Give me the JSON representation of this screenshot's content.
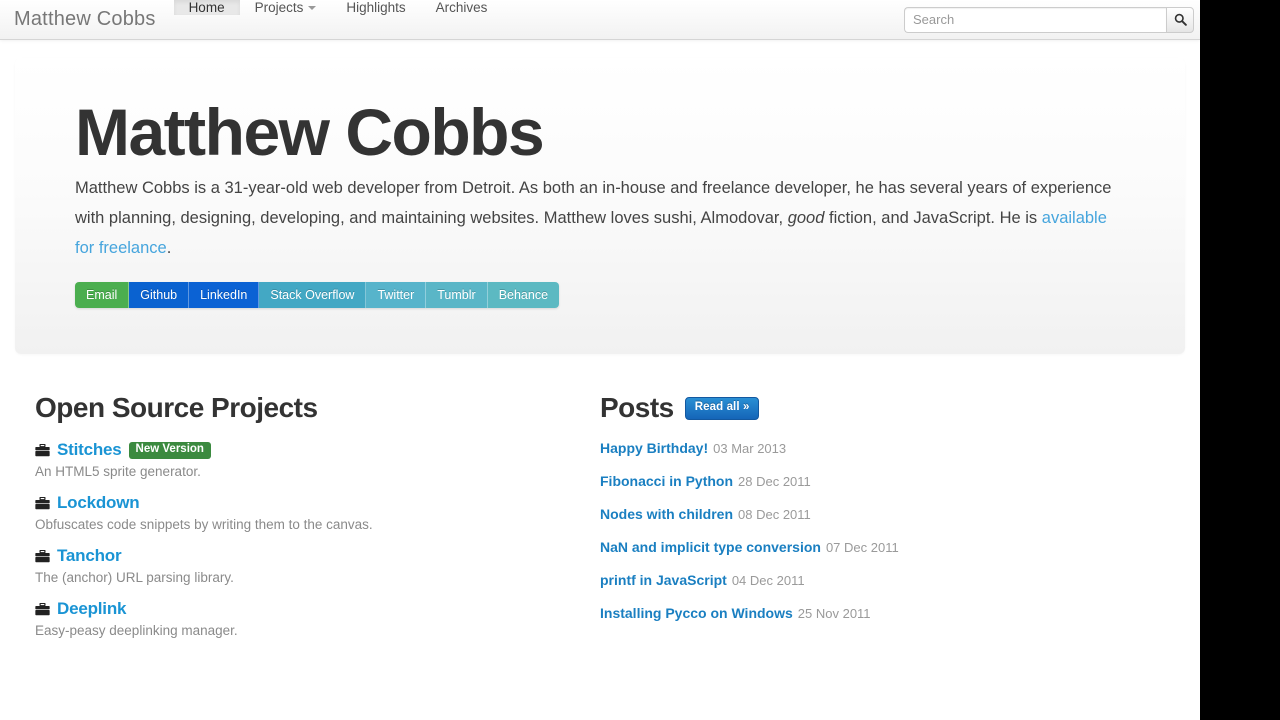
{
  "navbar": {
    "brand": "Matthew Cobbs",
    "items": [
      {
        "label": "Home",
        "active": true,
        "caret": false
      },
      {
        "label": "Projects",
        "active": false,
        "caret": true
      },
      {
        "label": "Highlights",
        "active": false,
        "caret": false
      },
      {
        "label": "Archives",
        "active": false,
        "caret": false
      }
    ],
    "search": {
      "placeholder": "Search",
      "value": "",
      "button_icon": "search-icon"
    }
  },
  "hero": {
    "title": "Matthew Cobbs",
    "bio_part1": "Matthew Cobbs is a 31-year-old web developer from Detroit. As both an in-house and freelance developer, he has several years of experience with planning, designing, developing, and maintaining websites. Matthew loves sushi, Almodovar, ",
    "bio_emphasis": "good",
    "bio_part2": " fiction, and JavaScript. He is ",
    "bio_link": "available for freelance",
    "bio_part3": ".",
    "social": [
      {
        "label": "Email",
        "color": "#4bae4f"
      },
      {
        "label": "Github",
        "color": "#0a62d0"
      },
      {
        "label": "LinkedIn",
        "color": "#0b62d4"
      },
      {
        "label": "Stack Overflow",
        "color": "#43a8c4"
      },
      {
        "label": "Twitter",
        "color": "#57b4cb"
      },
      {
        "label": "Tumblr",
        "color": "#5ab6c7"
      },
      {
        "label": "Behance",
        "color": "#5cb9c2"
      }
    ]
  },
  "projects": {
    "title": "Open Source Projects",
    "items": [
      {
        "icon": "briefcase-icon",
        "name": "Stitches",
        "badge": "New Version",
        "desc": "An HTML5 sprite generator."
      },
      {
        "icon": "briefcase-icon",
        "name": "Lockdown",
        "badge": "",
        "desc": "Obfuscates code snippets by writing them to the canvas."
      },
      {
        "icon": "briefcase-icon",
        "name": "Tanchor",
        "badge": "",
        "desc": "The (anchor) URL parsing library."
      },
      {
        "icon": "briefcase-icon",
        "name": "Deeplink",
        "badge": "",
        "desc": "Easy-peasy deeplinking manager."
      }
    ]
  },
  "posts": {
    "title": "Posts",
    "read_all_label": "Read all »",
    "items": [
      {
        "title": "Happy Birthday!",
        "date": "03 Mar 2013"
      },
      {
        "title": "Fibonacci in Python",
        "date": "28 Dec 2011"
      },
      {
        "title": "Nodes with children",
        "date": "08 Dec 2011"
      },
      {
        "title": "NaN and implicit type conversion",
        "date": "07 Dec 2011"
      },
      {
        "title": "printf in JavaScript",
        "date": "04 Dec 2011"
      },
      {
        "title": "Installing Pycco on Windows",
        "date": "25 Nov 2011"
      }
    ]
  },
  "theme": {
    "link_blue": "#1a94d4",
    "post_blue": "#1a7fc1",
    "badge_green": "#3b8a3f",
    "read_all_blue": "#1565b8"
  }
}
